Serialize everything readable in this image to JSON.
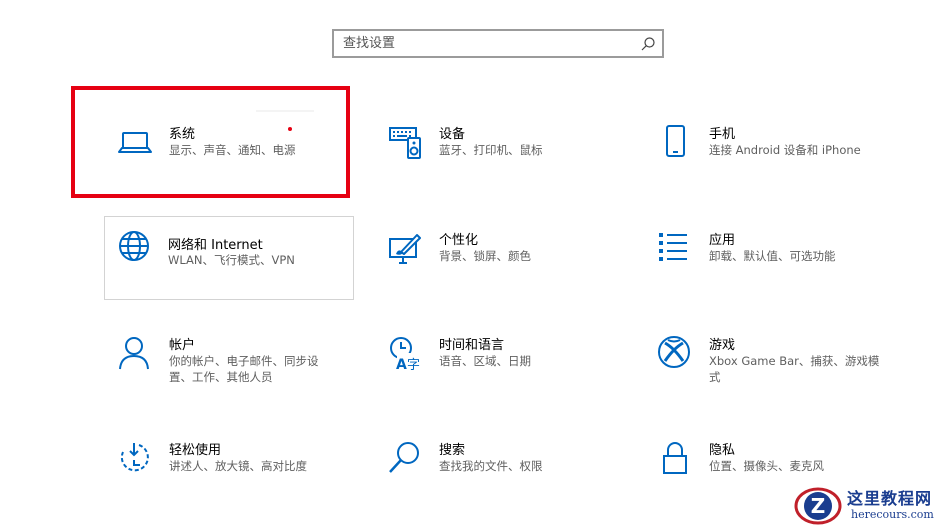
{
  "search": {
    "placeholder": "查找设置"
  },
  "colors": {
    "accent": "#0067c0",
    "highlight": "#e60012",
    "watermark": "#1a3d8f"
  },
  "tiles": [
    {
      "title": "系统",
      "desc": "显示、声音、通知、电源",
      "icon": "laptop-icon"
    },
    {
      "title": "设备",
      "desc": "蓝牙、打印机、鼠标",
      "icon": "keyboard-speaker-icon"
    },
    {
      "title": "手机",
      "desc": "连接 Android 设备和 iPhone",
      "icon": "phone-icon"
    },
    {
      "title": "网络和 Internet",
      "desc": "WLAN、飞行模式、VPN",
      "icon": "globe-icon"
    },
    {
      "title": "个性化",
      "desc": "背景、锁屏、颜色",
      "icon": "paint-monitor-icon"
    },
    {
      "title": "应用",
      "desc": "卸载、默认值、可选功能",
      "icon": "app-list-icon"
    },
    {
      "title": "帐户",
      "desc": "你的帐户、电子邮件、同步设置、工作、其他人员",
      "icon": "person-icon"
    },
    {
      "title": "时间和语言",
      "desc": "语音、区域、日期",
      "icon": "time-language-icon"
    },
    {
      "title": "游戏",
      "desc": "Xbox Game Bar、捕获、游戏模式",
      "icon": "xbox-icon"
    },
    {
      "title": "轻松使用",
      "desc": "讲述人、放大镜、高对比度",
      "icon": "ease-of-access-icon"
    },
    {
      "title": "搜索",
      "desc": "查找我的文件、权限",
      "icon": "search-magnifier-icon"
    },
    {
      "title": "隐私",
      "desc": "位置、摄像头、麦克风",
      "icon": "lock-icon"
    }
  ],
  "watermark": {
    "title": "这里教程网",
    "url": "herecours.com",
    "logo": "Z"
  }
}
